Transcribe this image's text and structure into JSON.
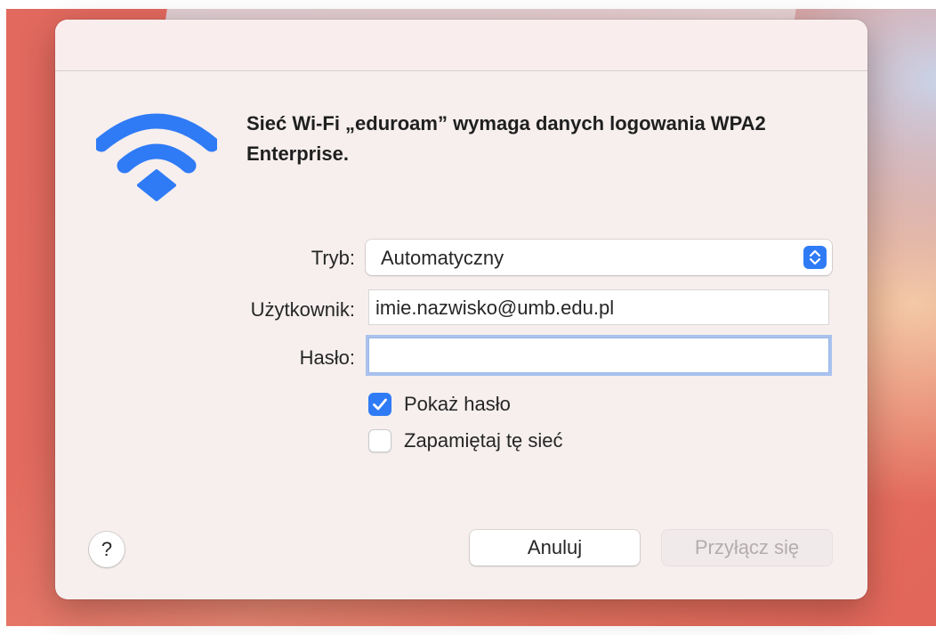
{
  "dialog": {
    "heading": "Sieć Wi-Fi „eduroam” wymaga danych logowania WPA2 Enterprise.",
    "icon": "wifi-icon",
    "accent_color": "#2f7bf6"
  },
  "form": {
    "mode": {
      "label": "Tryb:",
      "selected": "Automatyczny"
    },
    "username": {
      "label": "Użytkownik:",
      "value": "imie.nazwisko@umb.edu.pl"
    },
    "password": {
      "label": "Hasło:",
      "value": ""
    },
    "show_password": {
      "label": "Pokaż hasło",
      "checked": true
    },
    "remember_network": {
      "label": "Zapamiętaj tę sieć",
      "checked": false
    }
  },
  "buttons": {
    "help": "?",
    "cancel": "Anuluj",
    "connect": "Przyłącz się"
  }
}
